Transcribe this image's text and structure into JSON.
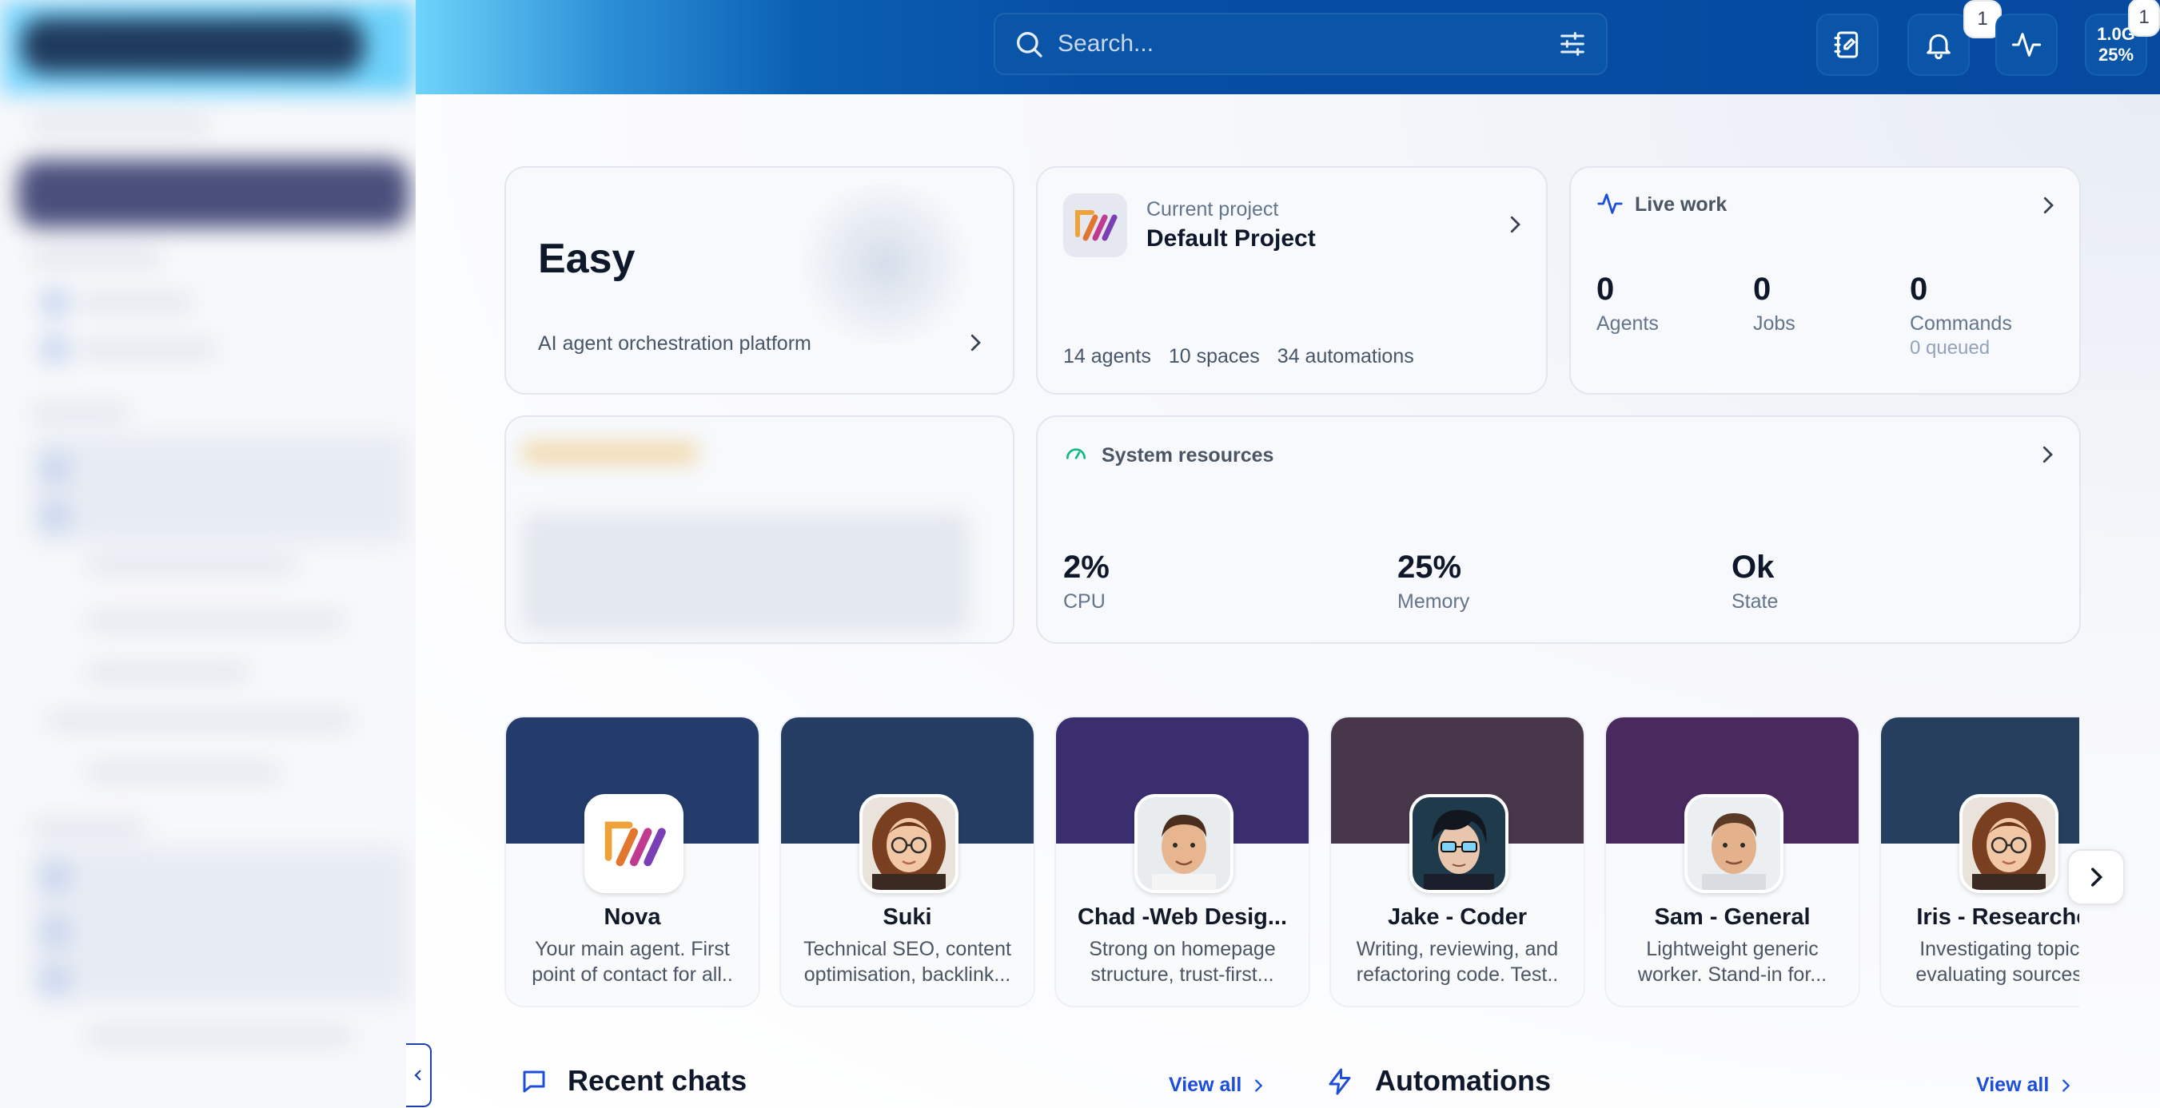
{
  "search": {
    "placeholder": "Search..."
  },
  "topbar": {
    "notification_badge": "1",
    "memory_value": "1.0G",
    "memory_percent": "25%",
    "memory_badge": "1"
  },
  "hero": {
    "title": "Easy",
    "subtitle": "AI agent orchestration platform"
  },
  "project": {
    "label": "Current project",
    "name": "Default Project",
    "agents": "14 agents",
    "spaces": "10 spaces",
    "automations": "34 automations"
  },
  "live_work": {
    "title": "Live work",
    "stats": [
      {
        "value": "0",
        "label": "Agents"
      },
      {
        "value": "0",
        "label": "Jobs"
      },
      {
        "value": "0",
        "label": "Commands",
        "sub": "0 queued"
      }
    ]
  },
  "resources": {
    "title": "System resources",
    "stats": [
      {
        "value": "2%",
        "label": "CPU"
      },
      {
        "value": "25%",
        "label": "Memory"
      },
      {
        "value": "Ok",
        "label": "State"
      }
    ]
  },
  "agents": [
    {
      "name": "Nova",
      "desc": "Your main agent. First point of contact for all..",
      "banner": "#233c6b"
    },
    {
      "name": "Suki",
      "desc": "Technical SEO, content optimisation, backlink...",
      "banner": "#253d63"
    },
    {
      "name": "Chad -Web Desig...",
      "desc": "Strong on homepage structure, trust-first...",
      "banner": "#3b2e6e"
    },
    {
      "name": "Jake - Coder",
      "desc": "Writing, reviewing, and refactoring code. Test..",
      "banner": "#48374a"
    },
    {
      "name": "Sam - General",
      "desc": "Lightweight generic worker. Stand-in for...",
      "banner": "#4a2a5e"
    },
    {
      "name": "Iris - Researcher",
      "desc": "Investigating topics, evaluating sources...",
      "banner": "#263f5f"
    }
  ],
  "recent_chats": {
    "title": "Recent chats",
    "view_all": "View all"
  },
  "automations": {
    "title": "Automations",
    "view_all": "View all"
  }
}
